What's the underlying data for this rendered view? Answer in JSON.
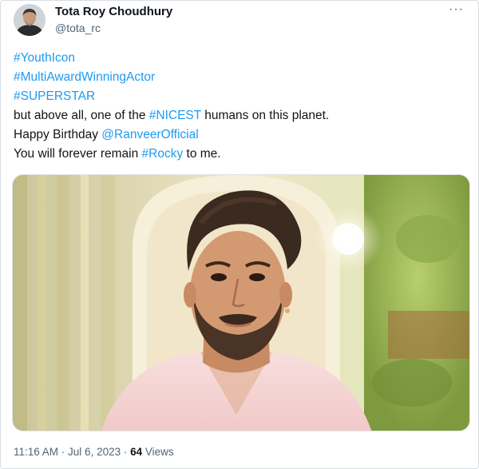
{
  "author": {
    "display_name": "Tota Roy Choudhury",
    "handle": "@tota_rc"
  },
  "menu": {
    "more_label": "···"
  },
  "tweet": {
    "line1": {
      "hashtag": "#YouthIcon"
    },
    "line2": {
      "hashtag": "#MultiAwardWinningActor"
    },
    "line3": {
      "hashtag": "#SUPERSTAR"
    },
    "line4": {
      "before": "but above all, one of the ",
      "hashtag": "#NICEST",
      "after": " humans on this planet."
    },
    "line5": {
      "before": "Happy Birthday ",
      "mention": "@RanveerOfficial"
    },
    "line6": {
      "before": "You will forever remain ",
      "hashtag": "#Rocky",
      "after": " to me."
    }
  },
  "meta": {
    "time": "11:16 AM",
    "separator1": " · ",
    "date": "Jul 6, 2023",
    "separator2": " · ",
    "views_count": "64",
    "views_label": " Views"
  },
  "colors": {
    "link": "#1d9bf0",
    "text": "#0f1419",
    "secondary": "#536471"
  },
  "icons": {
    "avatar": "profile-photo",
    "more": "more-options-icon"
  }
}
